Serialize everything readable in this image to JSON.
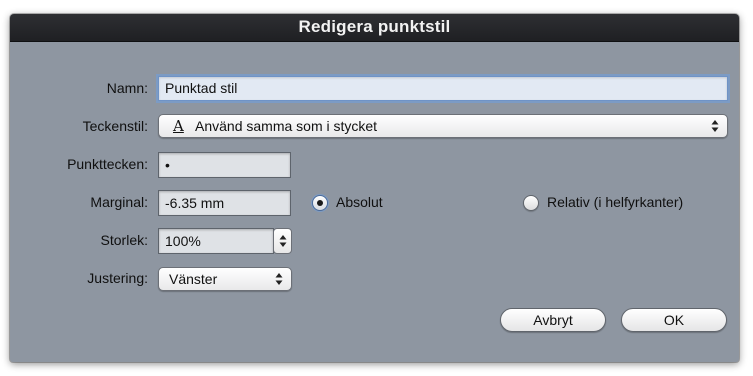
{
  "dialog": {
    "title": "Redigera punktstil"
  },
  "fields": {
    "name_label": "Namn:",
    "name_value": "Punktad stil",
    "font_label": "Teckenstil:",
    "font_glyph": "A",
    "font_value": "Använd samma som i stycket",
    "bullet_label": "Punkttecken:",
    "bullet_value": "•",
    "margin_label": "Marginal:",
    "margin_value": "-6.35 mm",
    "margin_absolute": "Absolut",
    "margin_relative": "Relativ (i helfyrkanter)",
    "size_label": "Storlek:",
    "size_value": "100%",
    "align_label": "Justering:",
    "align_value": "Vänster"
  },
  "state": {
    "margin_mode": "absolute"
  },
  "buttons": {
    "cancel": "Avbryt",
    "ok": "OK"
  },
  "icons": {
    "popup_arrows": "updown-arrows-icon",
    "font_glyph": "font-glyph-icon"
  },
  "colors": {
    "dialog_bg": "#8e96a1",
    "titlebar_bg": "#232428",
    "focus_ring": "#6ea0e1"
  }
}
